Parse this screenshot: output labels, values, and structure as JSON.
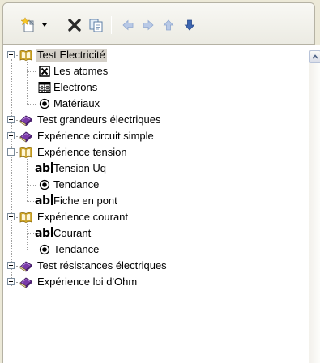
{
  "toolbar": {
    "buttons": [
      {
        "name": "new-item-icon"
      },
      {
        "name": "dropdown-arrow-icon"
      },
      {
        "name": "delete-icon"
      },
      {
        "name": "copy-icon"
      },
      {
        "name": "arrow-left-icon"
      },
      {
        "name": "arrow-right-icon"
      },
      {
        "name": "arrow-up-icon"
      },
      {
        "name": "arrow-down-icon"
      }
    ]
  },
  "tree": {
    "items": [
      {
        "label": "Test Electricité",
        "type": "book-open",
        "level": 0,
        "expanded": true,
        "selected": true
      },
      {
        "label": "Les atomes",
        "type": "checkbox-x",
        "level": 1
      },
      {
        "label": "Electrons",
        "type": "table",
        "level": 1
      },
      {
        "label": "Matériaux",
        "type": "radio",
        "level": 1
      },
      {
        "label": "Test grandeurs électriques",
        "type": "book-closed",
        "level": 0,
        "expanded": false
      },
      {
        "label": "Expérience circuit simple",
        "type": "book-closed",
        "level": 0,
        "expanded": false
      },
      {
        "label": "Expérience tension",
        "type": "book-open",
        "level": 0,
        "expanded": true
      },
      {
        "label": "Tension Uq",
        "type": "textfield",
        "level": 1
      },
      {
        "label": "Tendance",
        "type": "radio",
        "level": 1
      },
      {
        "label": "Fiche en pont",
        "type": "textfield",
        "level": 1
      },
      {
        "label": "Expérience courant",
        "type": "book-open",
        "level": 0,
        "expanded": true
      },
      {
        "label": "Courant",
        "type": "textfield",
        "level": 1
      },
      {
        "label": "Tendance",
        "type": "radio",
        "level": 1
      },
      {
        "label": "Test résistances  électriques",
        "type": "book-closed",
        "level": 0,
        "expanded": false
      },
      {
        "label": "Expérience loi d'Ohm",
        "type": "book-closed",
        "level": 0,
        "expanded": false
      }
    ],
    "textfield_icon_text": "ab"
  },
  "colors": {
    "background": "#ece9d8",
    "selection": "#d4d0c8",
    "book_open": "#e8b923",
    "book_closed": "#7a3aa8"
  }
}
